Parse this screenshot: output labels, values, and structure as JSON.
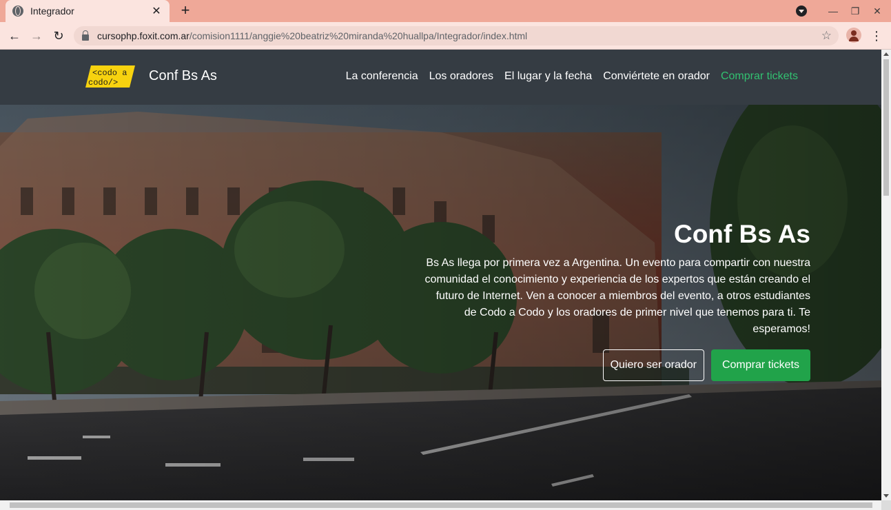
{
  "browser": {
    "tab_title": "Integrador",
    "tab_close": "✕",
    "new_tab": "+",
    "url_host": "cursophp.foxit.com.ar",
    "url_path": "/comision1111/anggie%20beatriz%20miranda%20huallpa/Integrador/index.html",
    "back": "←",
    "forward": "→",
    "reload": "↻",
    "star": "☆",
    "menu": "⋮",
    "minimize": "—",
    "restore": "❐",
    "close": "✕"
  },
  "navbar": {
    "logo_line1": "<codo a",
    "logo_line2": "codo/>",
    "brand": "Conf Bs As",
    "links": [
      "La conferencia",
      "Los oradores",
      "El lugar y la fecha",
      "Conviértete en orador",
      "Comprar tickets"
    ]
  },
  "hero": {
    "title": "Conf Bs As",
    "text": "Bs As llega por primera vez a Argentina. Un evento para compartir con nuestra comunidad el conocimiento y experiencia de los expertos que están creando el futuro de Internet. Ven a conocer a miembros del evento, a otros estudiantes de Codo a Codo y los oradores de primer nivel que tenemos para ti. Te esperamos!",
    "btn_speaker": "Quiero ser orador",
    "btn_tickets": "Comprar tickets"
  },
  "colors": {
    "tabbar": "#efa898",
    "navbar": "#353c43",
    "accent_green": "#21a34a",
    "link_green": "#32c171",
    "logo_yellow": "#f7d20f"
  }
}
